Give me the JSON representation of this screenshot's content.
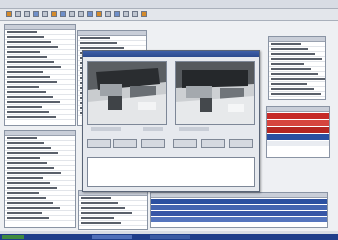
{
  "colors": {
    "taskbar": "#1f3e8a",
    "alarm_red": "#c62a27",
    "selection_blue": "#2b50a0",
    "accent_orange": "#d48a2a"
  },
  "toolbar_icons": [
    "folder-icon",
    "save-icon",
    "print-icon",
    "refresh-icon",
    "camera-icon",
    "zoom-icon",
    "stop-icon",
    "play-icon",
    "settings-icon",
    "help-icon",
    "user-icon",
    "lock-icon",
    "grid-icon",
    "export-icon",
    "warning-icon",
    "info-icon"
  ],
  "buttons": [
    {
      "label": ""
    },
    {
      "label": ""
    },
    {
      "label": ""
    },
    {
      "label": ""
    },
    {
      "label": ""
    },
    {
      "label": ""
    }
  ]
}
